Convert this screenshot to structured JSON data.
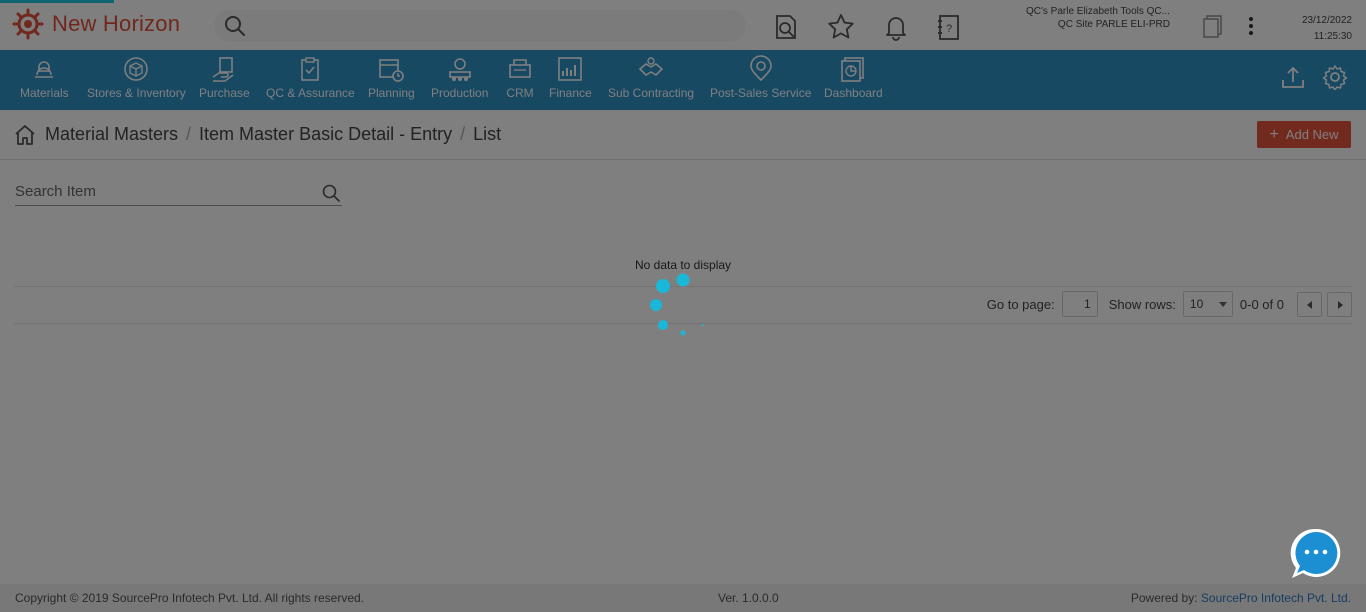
{
  "app": {
    "title": "New Horizon",
    "brand_color": "#e1503c",
    "search_placeholder": ""
  },
  "header": {
    "icons": [
      "document-search-icon",
      "star-icon",
      "bell-icon",
      "help-notebook-icon"
    ],
    "company_line1": "QC's Parle Elizabeth Tools QC...",
    "company_line2": "QC Site PARLE ELI-PRD",
    "date": "23/12/2022",
    "time": "11:25:30"
  },
  "modules": [
    {
      "label": "Materials",
      "icon": "materials-icon"
    },
    {
      "label": "Stores & Inventory",
      "icon": "stores-icon"
    },
    {
      "label": "Purchase",
      "icon": "purchase-icon"
    },
    {
      "label": "QC & Assurance",
      "icon": "qc-icon"
    },
    {
      "label": "Planning",
      "icon": "planning-icon"
    },
    {
      "label": "Production",
      "icon": "production-icon"
    },
    {
      "label": "CRM",
      "icon": "crm-icon"
    },
    {
      "label": "Finance",
      "icon": "finance-icon"
    },
    {
      "label": "Sub Contracting",
      "icon": "sub-contracting-icon"
    },
    {
      "label": "Post-Sales Service",
      "icon": "post-sales-icon"
    },
    {
      "label": "Dashboard",
      "icon": "dashboard-icon"
    }
  ],
  "module_bar_color": "#2e92c7",
  "breadcrumb": {
    "items": [
      "Material Masters",
      "Item Master Basic Detail - Entry",
      "List"
    ],
    "separator": "/"
  },
  "actions": {
    "add_new": "Add New",
    "add_new_color": "#e4533d"
  },
  "search": {
    "placeholder": "Search Item"
  },
  "table": {
    "empty_text": "No data to display"
  },
  "pagination": {
    "goto_label": "Go to page:",
    "page_value": "1",
    "rows_label": "Show rows:",
    "rows_value": "10",
    "range": "0-0 of 0"
  },
  "footer": {
    "copyright": "Copyright © 2019 SourcePro Infotech Pvt. Ltd. All rights reserved.",
    "version": "Ver. 1.0.0.0",
    "powered_label": "Powered by:",
    "powered_link": "SourcePro Infotech Pvt. Ltd."
  },
  "loading": {
    "spinner_color": "#1ab8d8",
    "overlay": true
  }
}
